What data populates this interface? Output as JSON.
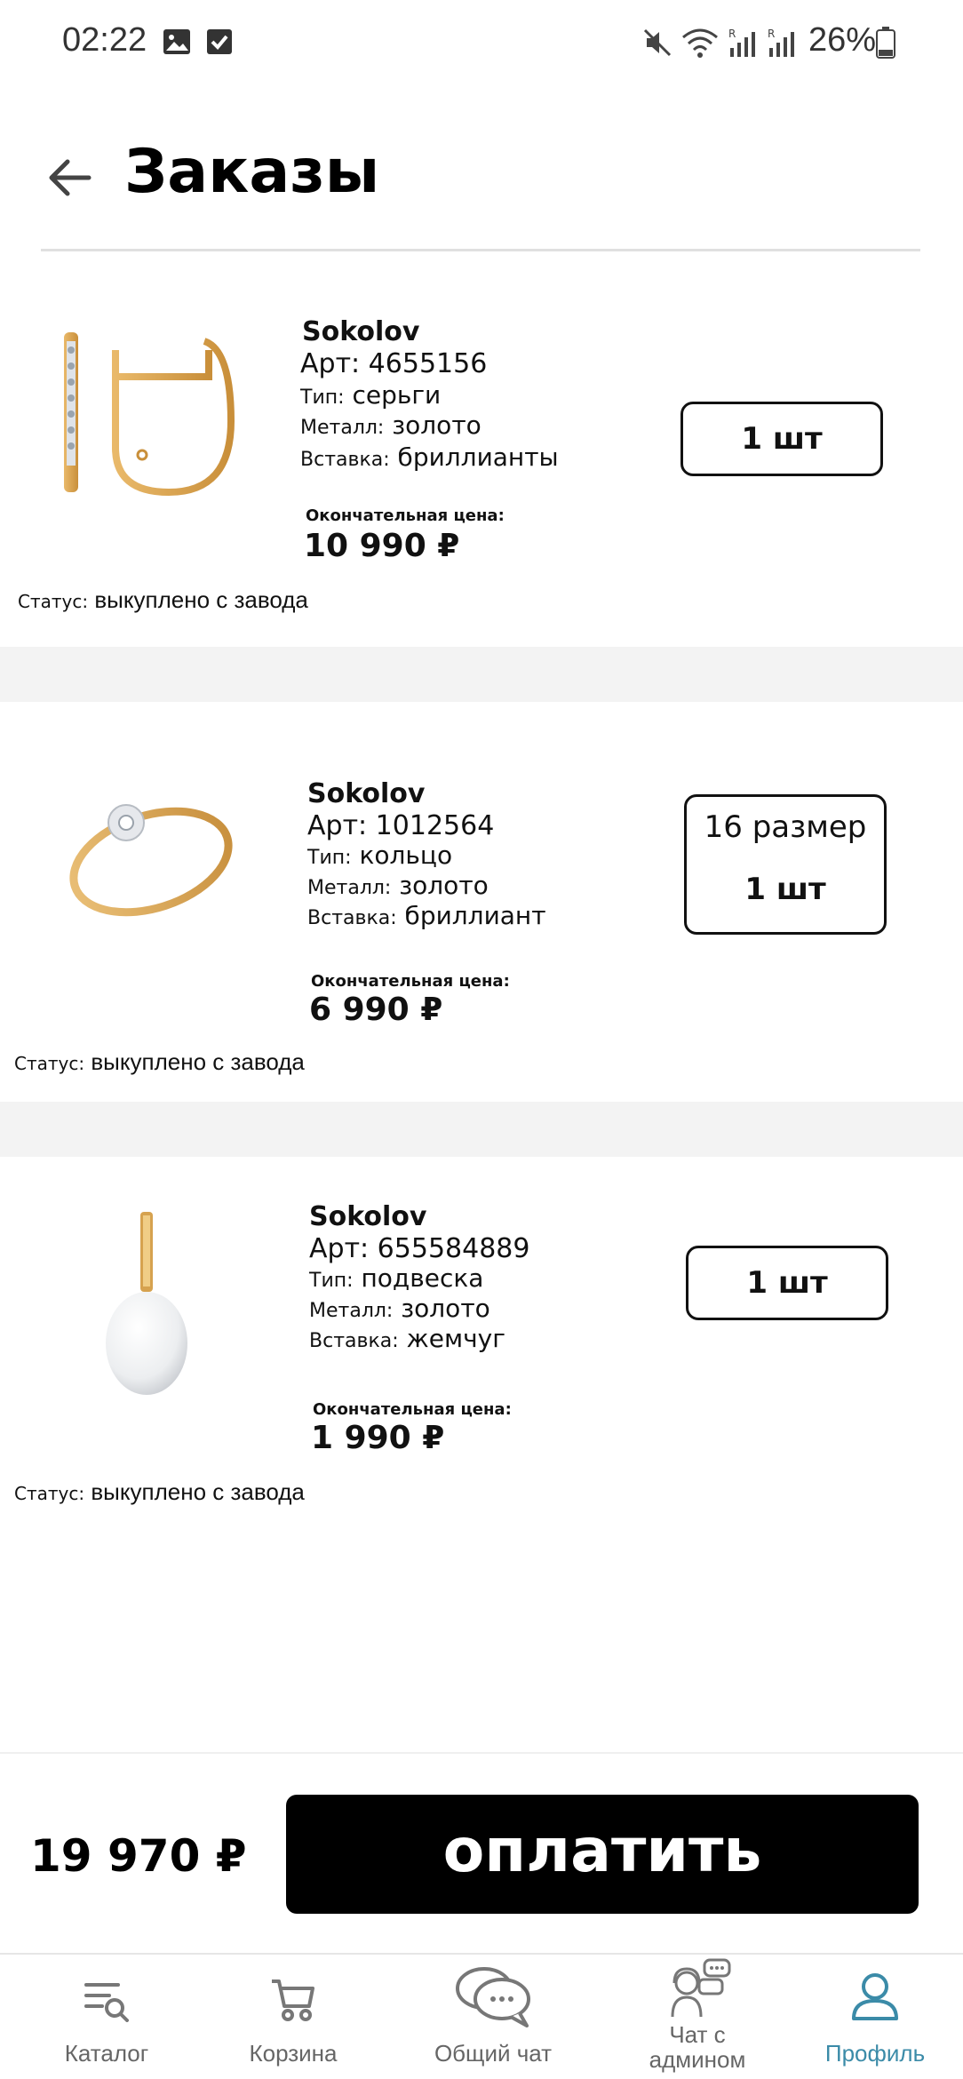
{
  "status_bar": {
    "time": "02:22",
    "battery": "26%"
  },
  "header": {
    "title": "Заказы"
  },
  "orders": [
    {
      "brand": "Sokolov",
      "art": "Арт: 4655156",
      "type_key": "Тип:",
      "type_val": "серьги",
      "metal_key": "Металл:",
      "metal_val": "золото",
      "insert_key": "Вставка:",
      "insert_val": "бриллианты",
      "price_label": "Окончательная цена:",
      "price": "10 990 ₽",
      "status_key": "Статус:",
      "status_val": "выкуплено с завода",
      "qty": "1 шт",
      "image": "earrings"
    },
    {
      "brand": "Sokolov",
      "art": "Арт: 1012564",
      "type_key": "Тип:",
      "type_val": "кольцо",
      "metal_key": "Металл:",
      "metal_val": "золото",
      "insert_key": "Вставка:",
      "insert_val": "бриллиант",
      "price_label": "Окончательная цена:",
      "price": "6 990 ₽",
      "status_key": "Статус:",
      "status_val": "выкуплено с завода",
      "size": "16 размер",
      "qty": "1 шт",
      "image": "ring"
    },
    {
      "brand": "Sokolov",
      "art": "Арт: 655584889",
      "type_key": "Тип:",
      "type_val": "подвеска",
      "metal_key": "Металл:",
      "metal_val": "золото",
      "insert_key": "Вставка:",
      "insert_val": "жемчуг",
      "price_label": "Окончательная цена:",
      "price": "1 990 ₽",
      "status_key": "Статус:",
      "status_val": "выкуплено с завода",
      "qty": "1 шт",
      "image": "pendant"
    }
  ],
  "footer": {
    "total": "19 970 ₽",
    "pay_label": "оплатить"
  },
  "nav": {
    "catalog": "Каталог",
    "cart": "Корзина",
    "chat": "Общий чат",
    "admin_chat_line1": "Чат с",
    "admin_chat_line2": "админом",
    "profile": "Профиль",
    "active_color": "#3b8ba8"
  }
}
